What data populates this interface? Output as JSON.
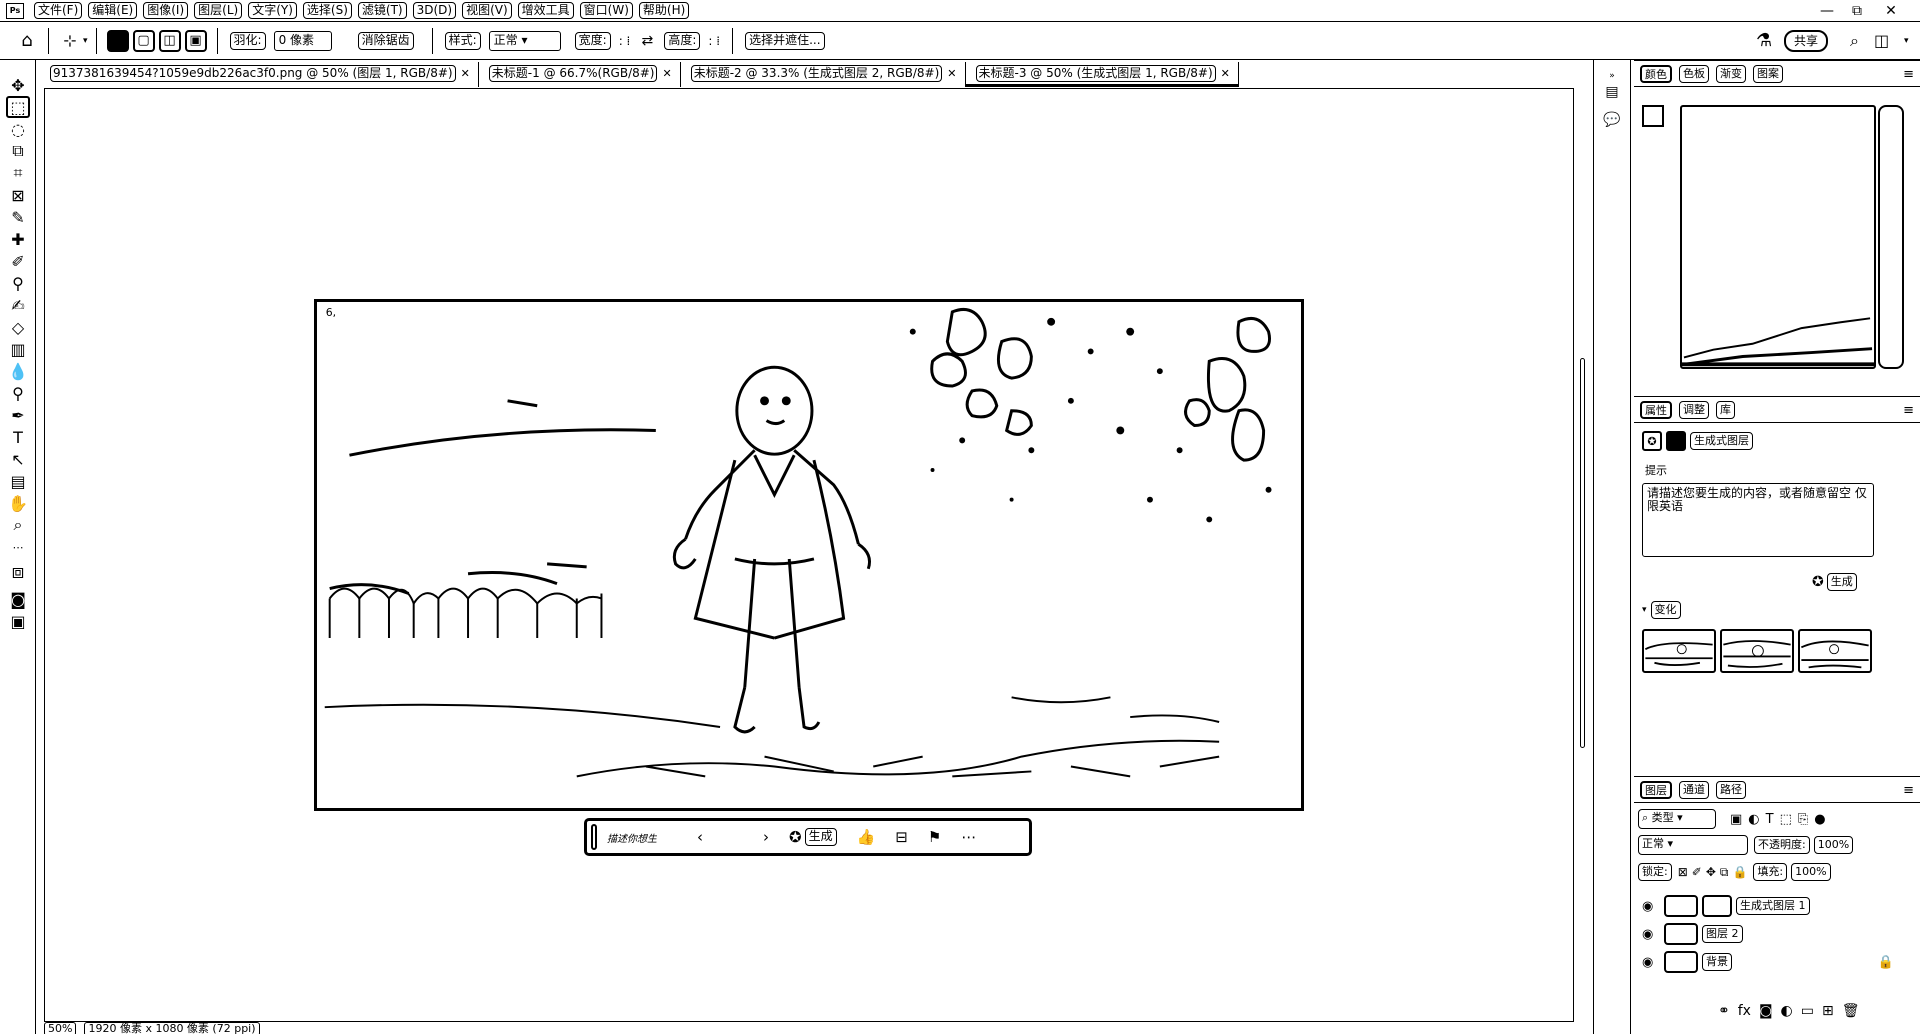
{
  "menubar": {
    "logo": "Ps",
    "items": [
      "文件(F)",
      "编辑(E)",
      "图像(I)",
      "图层(L)",
      "文字(Y)",
      "选择(S)",
      "滤镜(T)",
      "3D(D)",
      "视图(V)",
      "增效工具",
      "窗口(W)",
      "帮助(H)"
    ],
    "window_controls": [
      "—",
      "⧉",
      "✕"
    ]
  },
  "options": {
    "feather_label": "羽化:",
    "feather_value": "0 像素",
    "antialias_label": "消除锯齿",
    "style_label": "样式:",
    "style_value": "正常",
    "width_label": "宽度:",
    "height_label": "高度:",
    "select_mask_button": "选择并遮住...",
    "share_button": "共享"
  },
  "tabs": [
    {
      "label": "9137381639454?1059e9db226ac3f0.png @ 50% (图层 1, RGB/8#)",
      "active": false
    },
    {
      "label": "未标题-1 @ 66.7%(RGB/8#)",
      "active": false
    },
    {
      "label": "未标题-2 @ 33.3% (生成式图层 2, RGB/8#)",
      "active": false
    },
    {
      "label": "未标题-3 @ 50% (生成式图层 1, RGB/8#)",
      "active": true
    }
  ],
  "taskbar": {
    "prompt_placeholder": "描述你想生成",
    "generate_label": "生成"
  },
  "status": {
    "zoom": "50%",
    "dimensions": "1920 像素 x 1080 像素 (72 ppi)"
  },
  "properties": {
    "tabs": [
      "属性",
      "调整",
      "库"
    ],
    "layer_type": "生成式图层",
    "prompt_label": "提示",
    "prompt_text": "请描述您要生成的内容，或者随意留空 仅限英语",
    "generate_label": "生成",
    "variations_label": "变化"
  },
  "color_panel": {
    "tabs": [
      "颜色",
      "色板",
      "渐变",
      "图案"
    ]
  },
  "layers": {
    "tabs": [
      "图层",
      "通道",
      "路径"
    ],
    "filter_label": "类型",
    "blend_mode": "正常",
    "opacity_label": "不透明度:",
    "opacity_value": "100%",
    "lock_label": "锁定:",
    "fill_label": "填充:",
    "fill_value": "100%",
    "items": [
      {
        "name": "生成式图层 1"
      },
      {
        "name": "图层 2"
      },
      {
        "name": "背景"
      }
    ]
  }
}
